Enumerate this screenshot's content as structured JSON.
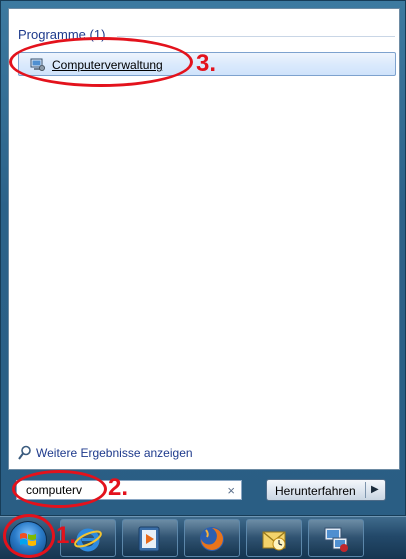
{
  "section": {
    "heading": "Programme (1)"
  },
  "results": [
    {
      "label": "Computerverwaltung",
      "icon": "computer-management-icon"
    }
  ],
  "more_results": {
    "label": "Weitere Ergebnisse anzeigen",
    "icon": "search-icon"
  },
  "search": {
    "value": "computerv",
    "clear_glyph": "×"
  },
  "shutdown": {
    "label": "Herunterfahren",
    "arrow_glyph": "▶"
  },
  "taskbar": {
    "items": [
      {
        "icon": "start-orb-icon"
      },
      {
        "icon": "internet-explorer-icon"
      },
      {
        "icon": "media-player-icon"
      },
      {
        "icon": "firefox-icon"
      },
      {
        "icon": "outlook-icon"
      },
      {
        "icon": "remote-desktop-icon"
      }
    ]
  },
  "annotations": {
    "step1": "1.",
    "step2": "2.",
    "step3": "3.",
    "color": "#e3121c"
  }
}
